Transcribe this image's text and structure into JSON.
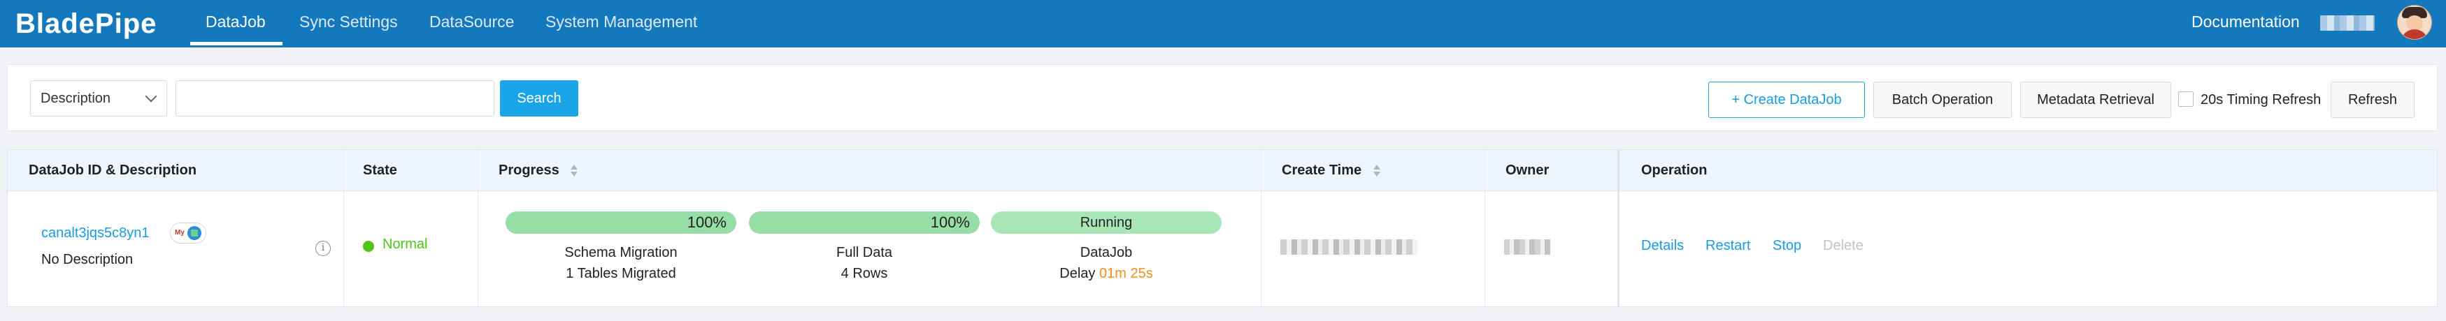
{
  "nav": {
    "logo": "BladePipe",
    "tabs": [
      {
        "label": "DataJob",
        "active": true
      },
      {
        "label": "Sync Settings",
        "active": false
      },
      {
        "label": "DataSource",
        "active": false
      },
      {
        "label": "System Management",
        "active": false
      }
    ],
    "documentation": "Documentation"
  },
  "toolbar": {
    "filter_select": "Description",
    "search_value": "",
    "search_button": "Search",
    "create_button": "+ Create DataJob",
    "batch_button": "Batch Operation",
    "metadata_button": "Metadata Retrieval",
    "timing_refresh_label": "20s Timing Refresh",
    "timing_refresh_checked": false,
    "refresh_button": "Refresh"
  },
  "table": {
    "columns": [
      "DataJob ID & Description",
      "State",
      "Progress",
      "Create Time",
      "Owner",
      "Operation"
    ],
    "rows": [
      {
        "job_id": "canalt3jqs5c8yn1",
        "description": "No Description",
        "state": "Normal",
        "progress": [
          {
            "percent_label": "100%",
            "percent": 100,
            "caption": "Schema Migration",
            "detail": "1 Tables Migrated"
          },
          {
            "percent_label": "100%",
            "percent": 100,
            "caption": "Full Data",
            "detail": "4 Rows"
          },
          {
            "status_label": "Running",
            "caption": "DataJob",
            "detail_prefix": "Delay",
            "delay": "01m 25s"
          }
        ],
        "operations": {
          "details": "Details",
          "restart": "Restart",
          "stop": "Stop",
          "delete": "Delete"
        }
      }
    ]
  },
  "colors": {
    "nav_bg": "#1478bd",
    "primary": "#1aa5e8",
    "link": "#1a9be0",
    "status_normal": "#52c41a",
    "progress_fill": "#96dea6",
    "delay": "#fa8c16"
  }
}
